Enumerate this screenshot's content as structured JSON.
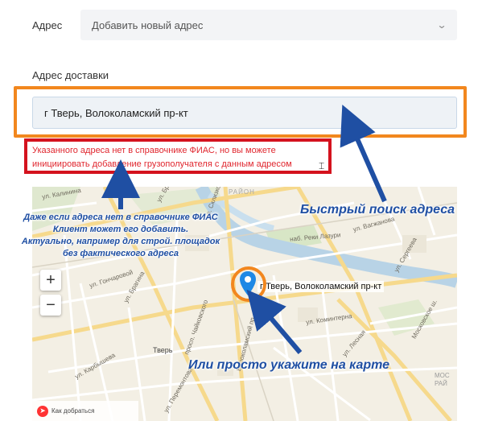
{
  "form": {
    "address_label": "Адрес",
    "address_select_value": "Добавить новый адрес",
    "delivery_label": "Адрес доставки",
    "delivery_input_value": "г Тверь, Волоколамский пр-кт",
    "error_message": "Указанного адреса нет в справочнике ФИАС, но вы можете инициировать добавление грузополучателя с данным адресом"
  },
  "icons": {
    "select_chevron": "chevron-down-icon",
    "zoom_in": "plus-icon",
    "zoom_out": "minus-icon",
    "map_pin": "map-pin-icon",
    "cursor": "text-cursor-icon"
  },
  "map": {
    "zoom_in_label": "+",
    "zoom_out_label": "−",
    "pin_label": "г Тверь, Волоколамский пр-кт",
    "city_label": "Тверь",
    "district_label": "РАЙОН",
    "moscow_label": "МОС\nРАЙ",
    "attribution": "Как добраться",
    "streets": [
      "ул. Калинина",
      "ул. Бра",
      "ул. Гончаровой",
      "просп. Чайковского",
      "ул. Брагина",
      "Волоколамский пр.",
      "наб. Реки Лазури",
      "ул. Вагжанова",
      "Московское ш.",
      "ул. Карбышева",
      "ул. Перемонтова",
      "ул. Коминтерна",
      "ул. Лесная",
      "ул. Склизкова",
      "ул. Сергеева"
    ]
  },
  "annotations": {
    "left_note": [
      "Даже если адреса нет в справочнике ФИАС",
      "Клиент может его добавить.",
      "Актуально, например для строй. площадок",
      "без фактического адреса"
    ],
    "right_note": "Быстрый поиск адреса",
    "bottom_note": "Или просто укажите на карте"
  },
  "colors": {
    "orange_frame": "#f2871e",
    "red_frame": "#d4121e",
    "annotation_blue": "#1f4fa3",
    "error_text": "#e0262e",
    "pin_blue": "#1e88e5"
  }
}
